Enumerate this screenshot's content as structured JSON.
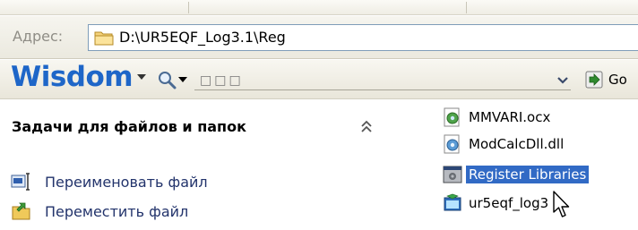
{
  "address_bar": {
    "label": "Адрес:",
    "path": "D:\\UR5EQF_Log3.1\\Reg"
  },
  "toolbar": {
    "brand": "Wisdom",
    "search_placeholder": "□□□",
    "go_label": "Go"
  },
  "task_pane": {
    "heading": "Задачи для файлов и папок",
    "tasks": [
      {
        "label": "Переименовать файл",
        "icon": "rename-icon"
      },
      {
        "label": "Переместить файл",
        "icon": "move-icon"
      }
    ]
  },
  "files": [
    {
      "name": "MMVARI.ocx",
      "icon": "activex-file-icon",
      "selected": false
    },
    {
      "name": "ModCalcDll.dll",
      "icon": "dll-file-icon",
      "selected": false
    },
    {
      "name": "Register Libraries",
      "icon": "batch-file-icon",
      "selected": true
    },
    {
      "name": "ur5eqf_log3",
      "icon": "application-icon",
      "selected": false
    }
  ],
  "colors": {
    "brand": "#1e66c8",
    "selection": "#316ac5",
    "task_text": "#22336b"
  }
}
